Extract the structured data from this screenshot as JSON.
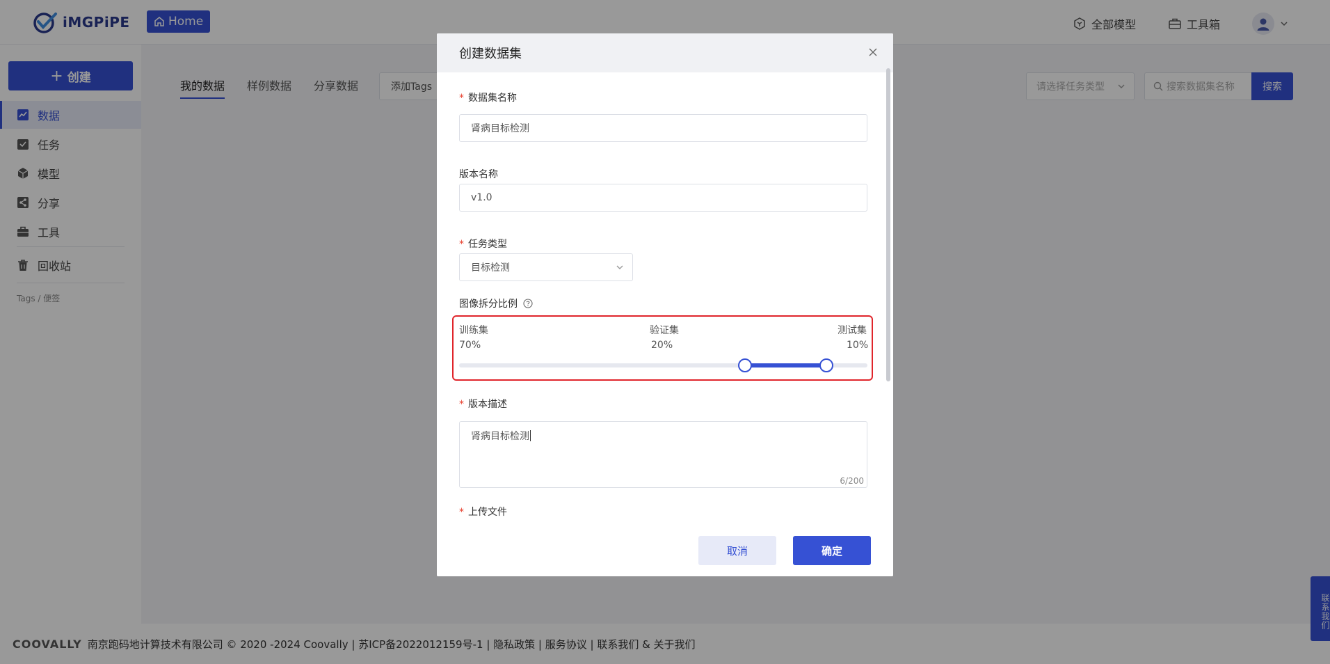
{
  "brand": {
    "logo_text": "iMGPiPE",
    "home_label": "Home"
  },
  "header": {
    "all_models": "全部模型",
    "toolbox": "工具箱"
  },
  "sidebar": {
    "create_label": "创建",
    "items": [
      {
        "label": "数据",
        "icon": "chart-icon"
      },
      {
        "label": "任务",
        "icon": "task-icon"
      },
      {
        "label": "模型",
        "icon": "cube-icon"
      },
      {
        "label": "分享",
        "icon": "share-icon"
      },
      {
        "label": "工具",
        "icon": "toolbox-icon"
      },
      {
        "label": "回收站",
        "icon": "trash-icon"
      }
    ],
    "tags_label": "Tags / 便签"
  },
  "main": {
    "tabs": [
      "我的数据",
      "样例数据",
      "分享数据"
    ],
    "tag_input_label": "添加Tags",
    "task_type_placeholder": "请选择任务类型",
    "search_placeholder": "搜索数据集名称",
    "search_button": "搜索"
  },
  "footer": {
    "brand": "COOVALLY",
    "text": "南京跑码地计算技术有限公司 © 2020 -2024 Coovally | 苏ICP备2022012159号-1 | 隐私政策 | 服务协议 | 联系我们 & 关于我们"
  },
  "contact_tab": "联系我们",
  "modal": {
    "title": "创建数据集",
    "dataset_name_label": "数据集名称",
    "dataset_name_value": "肾病目标检测",
    "version_name_label": "版本名称",
    "version_name_value": "v1.0",
    "task_type_label": "任务类型",
    "task_type_value": "目标检测",
    "split_label": "图像拆分比例",
    "split": {
      "train_label": "训练集",
      "train_value": "70%",
      "val_label": "验证集",
      "val_value": "20%",
      "test_label": "测试集",
      "test_value": "10%",
      "train_pct": 70,
      "val_pct": 20,
      "test_pct": 10
    },
    "version_desc_label": "版本描述",
    "version_desc_value": "肾病目标检测",
    "char_counter": "6/200",
    "upload_label": "上传文件",
    "cancel": "取消",
    "ok": "确定"
  },
  "colors": {
    "accent": "#3651d4",
    "required": "#e8402e",
    "highlight": "#e0252b"
  }
}
